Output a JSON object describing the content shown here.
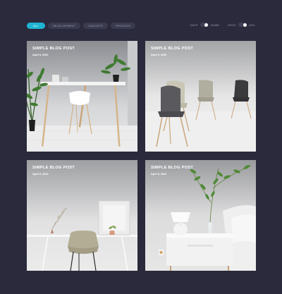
{
  "filters": [
    {
      "label": "ALL",
      "active": true
    },
    {
      "label": "DEVELOPMENT",
      "active": false
    },
    {
      "label": "GADGETS",
      "active": false
    },
    {
      "label": "PROCESS",
      "active": false
    }
  ],
  "sort": {
    "field": {
      "left_label": "DATE",
      "right_label": "NAME"
    },
    "order": {
      "left_label": "DESC",
      "right_label": "ASC"
    }
  },
  "posts": [
    {
      "title": "SIMPLE BLOG POST",
      "date": "April 5, 2020"
    },
    {
      "title": "SIMPLE BLOG POST",
      "date": "April 5, 2020"
    },
    {
      "title": "SIMPLE BLOG POST",
      "date": "April 5, 2020"
    },
    {
      "title": "SIMPLE BLOG POST",
      "date": "April 5, 2020"
    }
  ],
  "colors": {
    "background": "#2a2a3c",
    "accent": "#1fb3d2",
    "pill": "#3a3b4e"
  }
}
